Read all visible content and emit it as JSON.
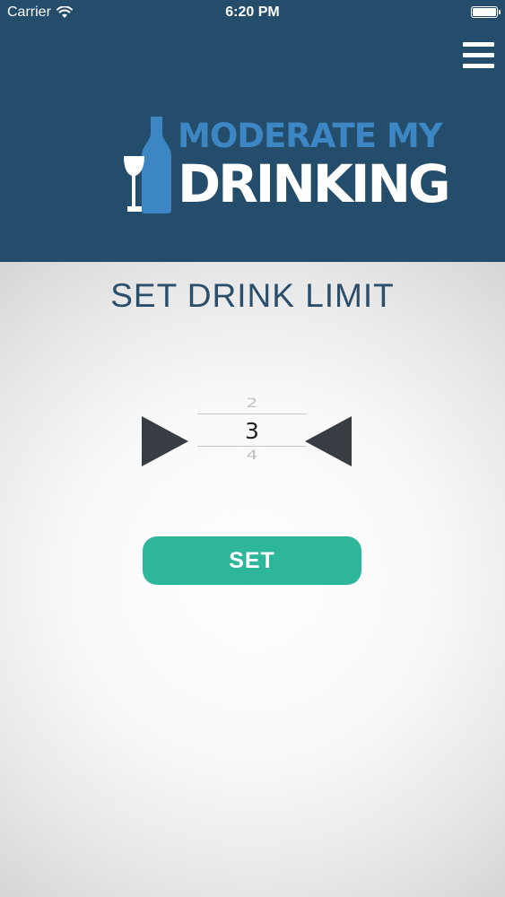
{
  "status_bar": {
    "carrier": "Carrier",
    "carrier_icon": "wifi-icon",
    "time": "6:20 PM",
    "battery_icon": "battery-icon"
  },
  "header": {
    "background_color": "#244d6b",
    "menu_icon": "hamburger-menu-icon",
    "logo": {
      "line1": "MODERATE MY",
      "line2": "DRINKING",
      "line1_color": "#3c86c4",
      "line2_color": "#ffffff",
      "icons": [
        "wine-bottle-icon",
        "wine-glass-icon"
      ]
    }
  },
  "main": {
    "title": "SET DRINK LIMIT",
    "title_color": "#2b4e6b",
    "picker": {
      "previous": "2",
      "current": "3",
      "next": "4",
      "increase_icon": "triangle-right-icon",
      "decrease_icon": "triangle-left-icon",
      "arrow_color": "#383d44"
    },
    "set_button": {
      "label": "SET",
      "color": "#2eb69a"
    }
  }
}
